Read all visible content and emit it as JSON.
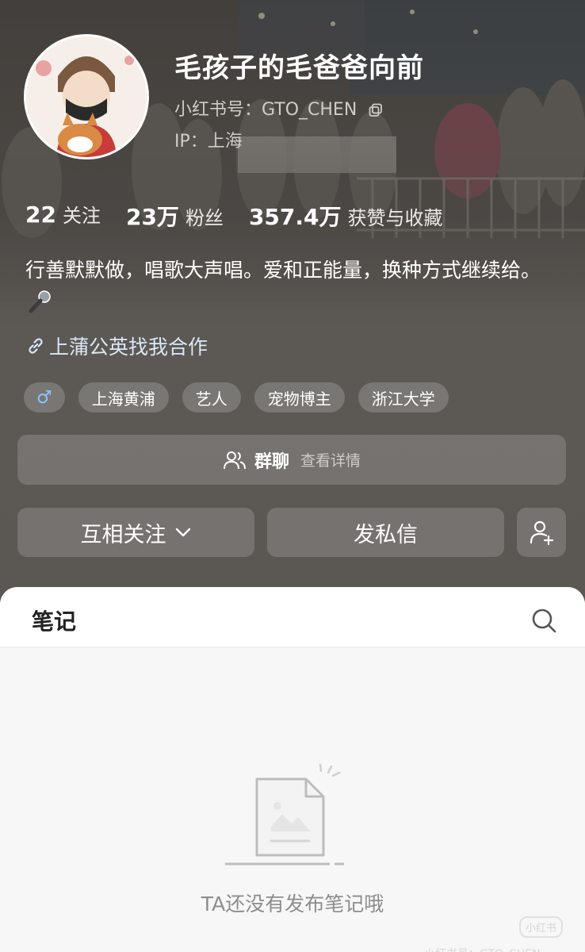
{
  "profile": {
    "name": "毛孩子的毛爸爸向前",
    "account_id": "小红书号：GTO_CHEN",
    "ip_location": "IP：上海"
  },
  "stats": [
    {
      "value": "22",
      "label": "关注"
    },
    {
      "value": "23万",
      "label": "粉丝"
    },
    {
      "value": "357.4万",
      "label": "获赞与收藏"
    }
  ],
  "bio": "行善默默做，唱歌大声唱。爱和正能量，换种方式继续给。",
  "collab_link": "上蒲公英找我合作",
  "tags": [
    {
      "label": "♂"
    },
    {
      "label": "上海黄浦"
    },
    {
      "label": "艺人"
    },
    {
      "label": "宠物博主"
    },
    {
      "label": "浙江大学"
    }
  ],
  "group_chat": {
    "title": "群聊",
    "subtitle": "查看详情"
  },
  "actions": {
    "follow_label": "互相关注",
    "message_label": "发私信"
  },
  "notes": {
    "tab_label": "笔记",
    "empty_text": "TA还没有发布笔记哦"
  },
  "watermark": {
    "logo": "小红书",
    "text": "小红书号：GTO_CHEN"
  },
  "colors": {
    "header_bg": "#5b5854",
    "gender_icon": "#8ec2ff",
    "link": "#dbe7f7"
  }
}
